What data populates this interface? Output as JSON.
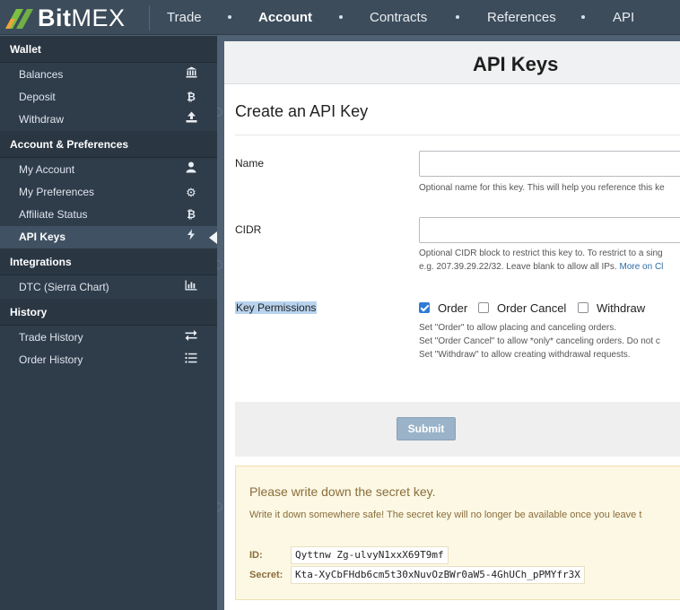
{
  "brand": {
    "name_bold": "Bit",
    "name_rest": "MEX",
    "logo_colors": [
      "#7ac143",
      "#f2a33a"
    ]
  },
  "nav": {
    "items": [
      {
        "label": "Trade",
        "active": false
      },
      {
        "label": "Account",
        "active": true
      },
      {
        "label": "Contracts",
        "active": false
      },
      {
        "label": "References",
        "active": false
      },
      {
        "label": "API",
        "active": false
      }
    ]
  },
  "sidebar": {
    "wallet": {
      "heading": "Wallet",
      "items": [
        {
          "label": "Balances",
          "icon": "bank-icon"
        },
        {
          "label": "Deposit",
          "icon": "bitcoin-icon"
        },
        {
          "label": "Withdraw",
          "icon": "upload-icon"
        }
      ]
    },
    "account": {
      "heading": "Account & Preferences",
      "items": [
        {
          "label": "My Account",
          "icon": "user-icon"
        },
        {
          "label": "My Preferences",
          "icon": "gear-icon"
        },
        {
          "label": "Affiliate Status",
          "icon": "bitcoin-icon"
        },
        {
          "label": "API Keys",
          "icon": "bolt-icon",
          "active": true
        }
      ]
    },
    "integrations": {
      "heading": "Integrations",
      "items": [
        {
          "label": "DTC (Sierra Chart)",
          "icon": "bar-chart-icon"
        }
      ]
    },
    "history": {
      "heading": "History",
      "items": [
        {
          "label": "Trade History",
          "icon": "exchange-icon"
        },
        {
          "label": "Order History",
          "icon": "list-icon"
        }
      ]
    }
  },
  "page": {
    "title": "API Keys",
    "section_title": "Create an API Key",
    "name_label": "Name",
    "name_value": "",
    "name_help": "Optional name for this key. This will help you reference this ke",
    "cidr_label": "CIDR",
    "cidr_value": "",
    "cidr_help_1": "Optional CIDR block to restrict this key to. To restrict to a sing",
    "cidr_help_2": "e.g. 207.39.29.22/32. Leave blank to allow all IPs.",
    "cidr_help_link": "More on Cl",
    "perm_label": "Key Permissions",
    "permissions": [
      {
        "label": "Order",
        "checked": true
      },
      {
        "label": "Order Cancel",
        "checked": false
      },
      {
        "label": "Withdraw",
        "checked": false
      }
    ],
    "perm_help": [
      "Set \"Order\" to allow placing and canceling orders.",
      "Set \"Order Cancel\" to allow *only* canceling orders. Do not c",
      "Set \"Withdraw\" to allow creating withdrawal requests."
    ],
    "submit_label": "Submit"
  },
  "secret": {
    "title": "Please write down the secret key.",
    "note": "Write it down somewhere safe! The secret key will no longer be available once you leave t",
    "id_label": "ID:",
    "id_value": "Qyttnw Zg-ulvyN1xxX69T9mf",
    "secret_label": "Secret:",
    "secret_value": "Kta-XyCbFHdb6cm5t30xNuvOzBWr0aW5-4GhUCh_pPMYfr3X"
  }
}
